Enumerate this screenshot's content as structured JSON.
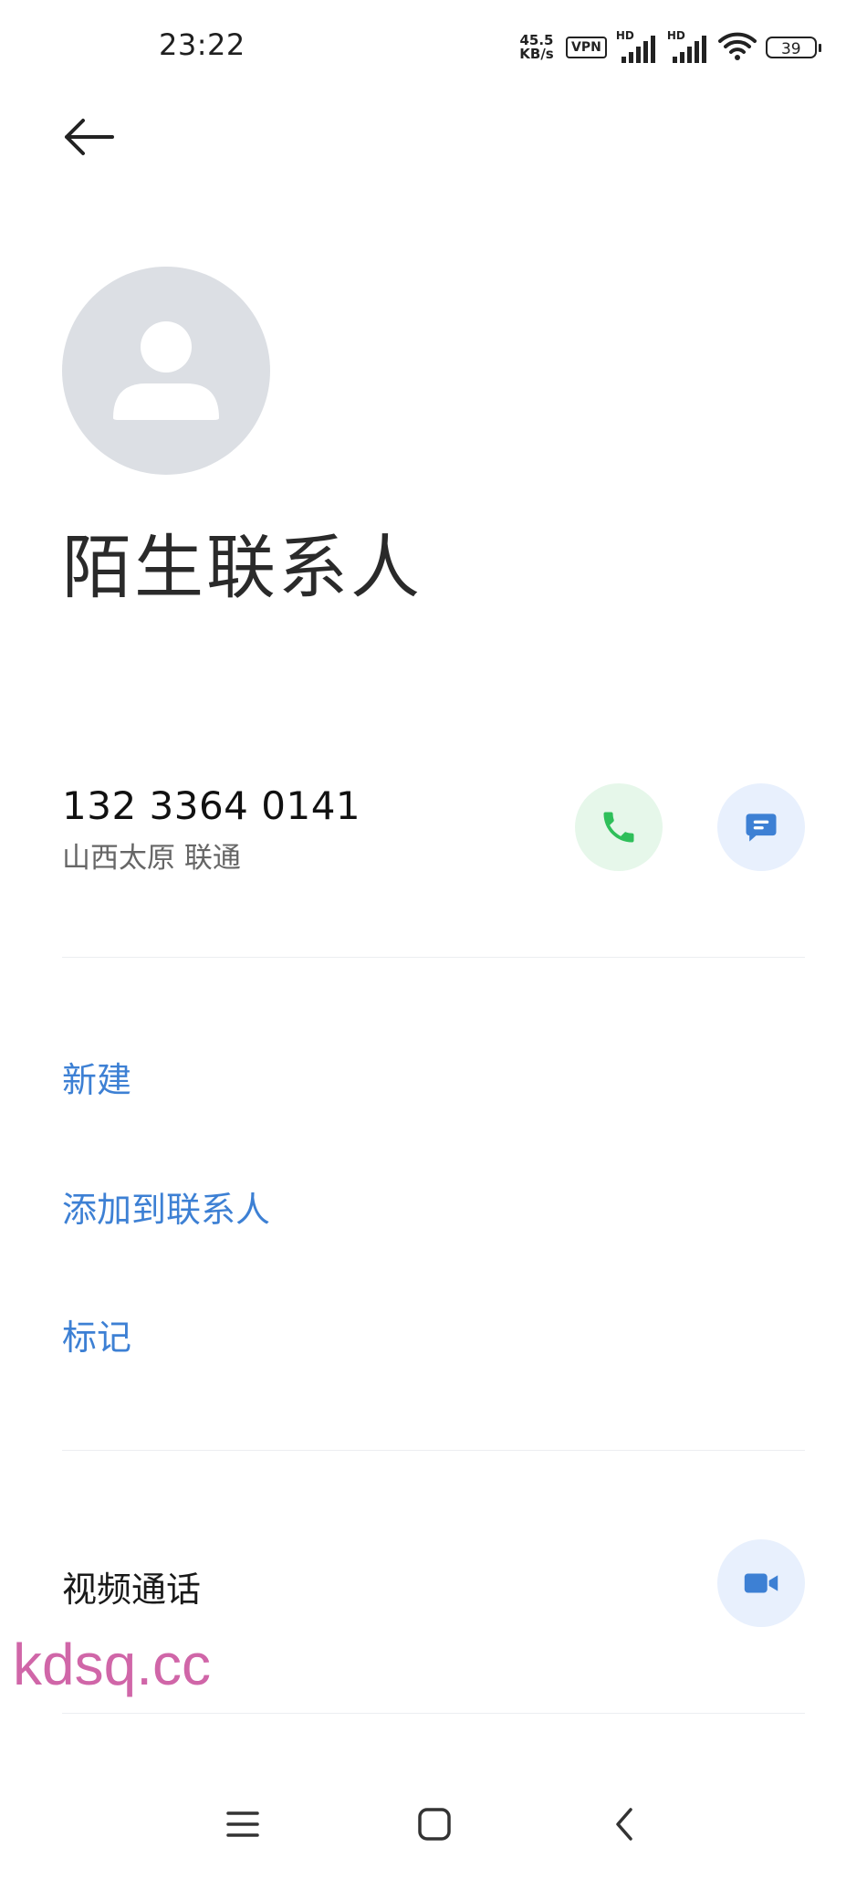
{
  "status_bar": {
    "time": "23:22",
    "net_speed_value": "45.5",
    "net_speed_unit": "KB/s",
    "vpn": "VPN",
    "sim1_label": "HD",
    "sim2_label": "HD",
    "battery": "39",
    "icons": [
      "signal-icon",
      "signal-icon",
      "wifi-icon",
      "battery-icon"
    ]
  },
  "header": {
    "back_icon": "arrow-left-icon"
  },
  "contact": {
    "name": "陌生联系人",
    "avatar_icon": "person-icon",
    "phone": "132 3364 0141",
    "location": "山西太原 联通"
  },
  "actions": {
    "new": "新建",
    "add_to_contacts": "添加到联系人",
    "mark": "标记"
  },
  "video_call": {
    "label": "视频通话",
    "icon": "video-camera-icon"
  },
  "watermark": "kdsq.cc",
  "nav_bar": {
    "icons": [
      "menu-icon",
      "home-icon",
      "back-icon"
    ]
  },
  "colors": {
    "accent": "#3d80d4",
    "call_green": "#2fbf5a",
    "call_bg": "#e6f7ea",
    "message_bg": "#e8f0fd",
    "avatar_bg": "#dcdfe4",
    "watermark": "#d066a8"
  }
}
